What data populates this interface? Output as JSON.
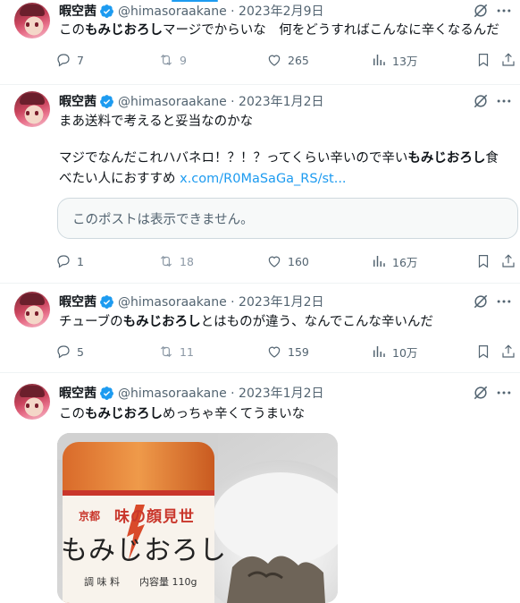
{
  "tweets": [
    {
      "name": "暇空茜",
      "handle": "@himasoraakane · 2023年2月9日",
      "text_pre": "この",
      "text_bold": "もみじおろし",
      "text_post": "マージでからいな　何をどうすればこんなに辛くなるんだ",
      "replies": "7",
      "retweets": "9",
      "likes": "265",
      "views": "13万"
    },
    {
      "name": "暇空茜",
      "handle": "@himasoraakane · 2023年1月2日",
      "line1": "まあ送料で考えると妥当なのかな",
      "line2_pre": "マジでなんだこれハバネロ！？！？ってくらい辛いので辛い",
      "line2_bold": "もみじおろし",
      "line2_post": "食",
      "line3_pre": "べたい人におすすめ ",
      "link": "x.com/R0MaSaGa_RS/st...",
      "quote": "このポストは表示できません。",
      "replies": "1",
      "retweets": "18",
      "likes": "160",
      "views": "16万"
    },
    {
      "name": "暇空茜",
      "handle": "@himasoraakane · 2023年1月2日",
      "text_pre": "チューブの",
      "text_bold": "もみじおろし",
      "text_post": "とはものが違う、なんでこんな辛いんだ",
      "replies": "5",
      "retweets": "11",
      "likes": "159",
      "views": "10万"
    },
    {
      "name": "暇空茜",
      "handle": "@himasoraakane · 2023年1月2日",
      "text_pre": "この",
      "text_bold": "もみじおろし",
      "text_post": "めっちゃ辛くてうまいな"
    }
  ],
  "photo_label": {
    "region": "京都",
    "brand": "味の顔見世",
    "product": "もみじおろし",
    "type": "調 味 料",
    "capacity": "内容量 110g"
  },
  "colors": {
    "accent": "#1d9bf0",
    "secondary_text": "#536471",
    "border": "#eff3f4"
  },
  "icons": [
    "reply-icon",
    "retweet-icon",
    "like-icon",
    "views-icon",
    "bookmark-icon",
    "share-icon",
    "grok-icon",
    "more-icon",
    "verified-badge-icon"
  ]
}
